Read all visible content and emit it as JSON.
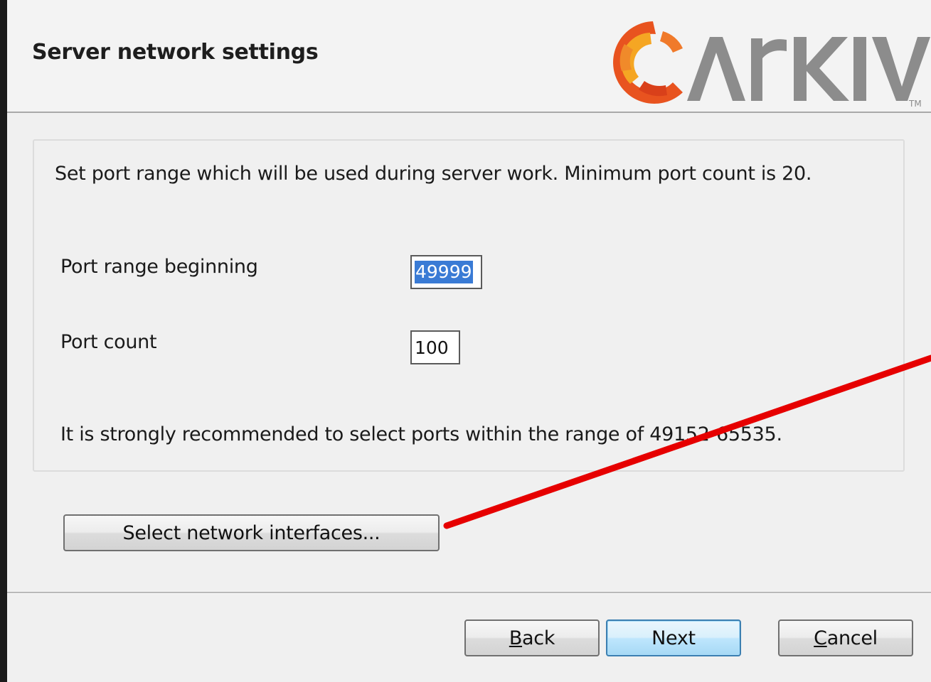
{
  "header": {
    "title": "Server network settings",
    "logo_text": "ARKIV",
    "logo_tm": "TM",
    "logo_colors": {
      "orange": "#e8531f",
      "yellow": "#f5a623",
      "gray": "#8c8c8c"
    }
  },
  "main": {
    "description": "Set port range which will be used during server work. Minimum port count is 20.",
    "fields": {
      "port_range_beginning": {
        "label": "Port range beginning",
        "value": "49999",
        "selected": true
      },
      "port_count": {
        "label": "Port count",
        "value": "100"
      }
    },
    "recommendation": "It is strongly recommended to select ports within the range of 49152-65535.",
    "select_interfaces_label": "Select network interfaces..."
  },
  "footer": {
    "back_label_prefix": "",
    "back_label_mnemonic": "B",
    "back_label_rest": "ack",
    "next_label": "Next",
    "cancel_label_mnemonic": "C",
    "cancel_label_rest": "ancel"
  },
  "annotation": {
    "arrow_color": "#e60000"
  }
}
